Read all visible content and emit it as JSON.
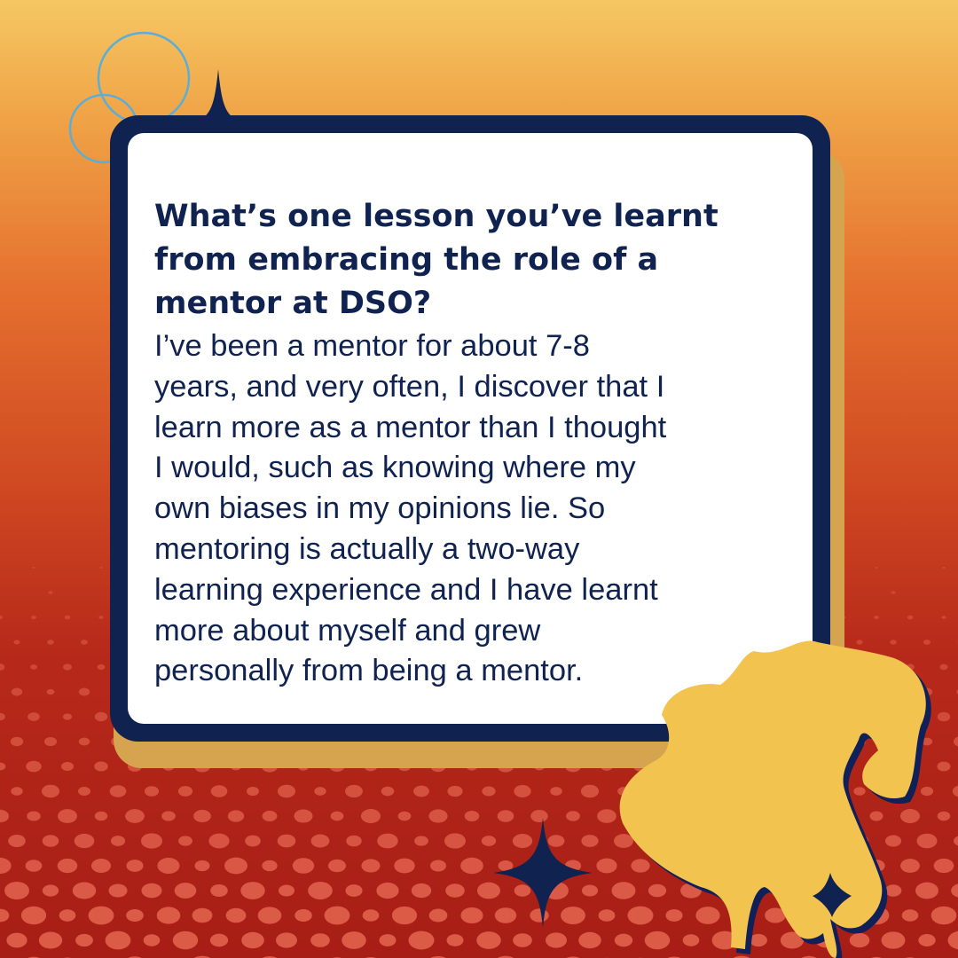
{
  "card": {
    "question": "What’s one lesson you’ve learnt from embracing the role of a mentor at DSO?",
    "answer_lines": [
      "I’ve been a mentor for about 7-8",
      "years, and very often, I discover that I",
      "learn more as a mentor than I thought",
      "I would, such as knowing where my",
      "own biases in my opinions lie. So",
      "mentoring is actually a two-way",
      "learning experience and I have learnt",
      "more about myself and grew",
      "personally from being a mentor."
    ]
  },
  "icons": {
    "circles": "decorative-circles-icon",
    "sparkles": "sparkle-star-icon",
    "figure": "flying-figure-silhouette-icon"
  },
  "colors": {
    "navy": "#10224f",
    "gold": "#f3c350",
    "card_shadow": "#d6a44e",
    "circle_outline": "#5aaed8",
    "background_top": "#f5c763",
    "background_bottom": "#a71e16"
  }
}
